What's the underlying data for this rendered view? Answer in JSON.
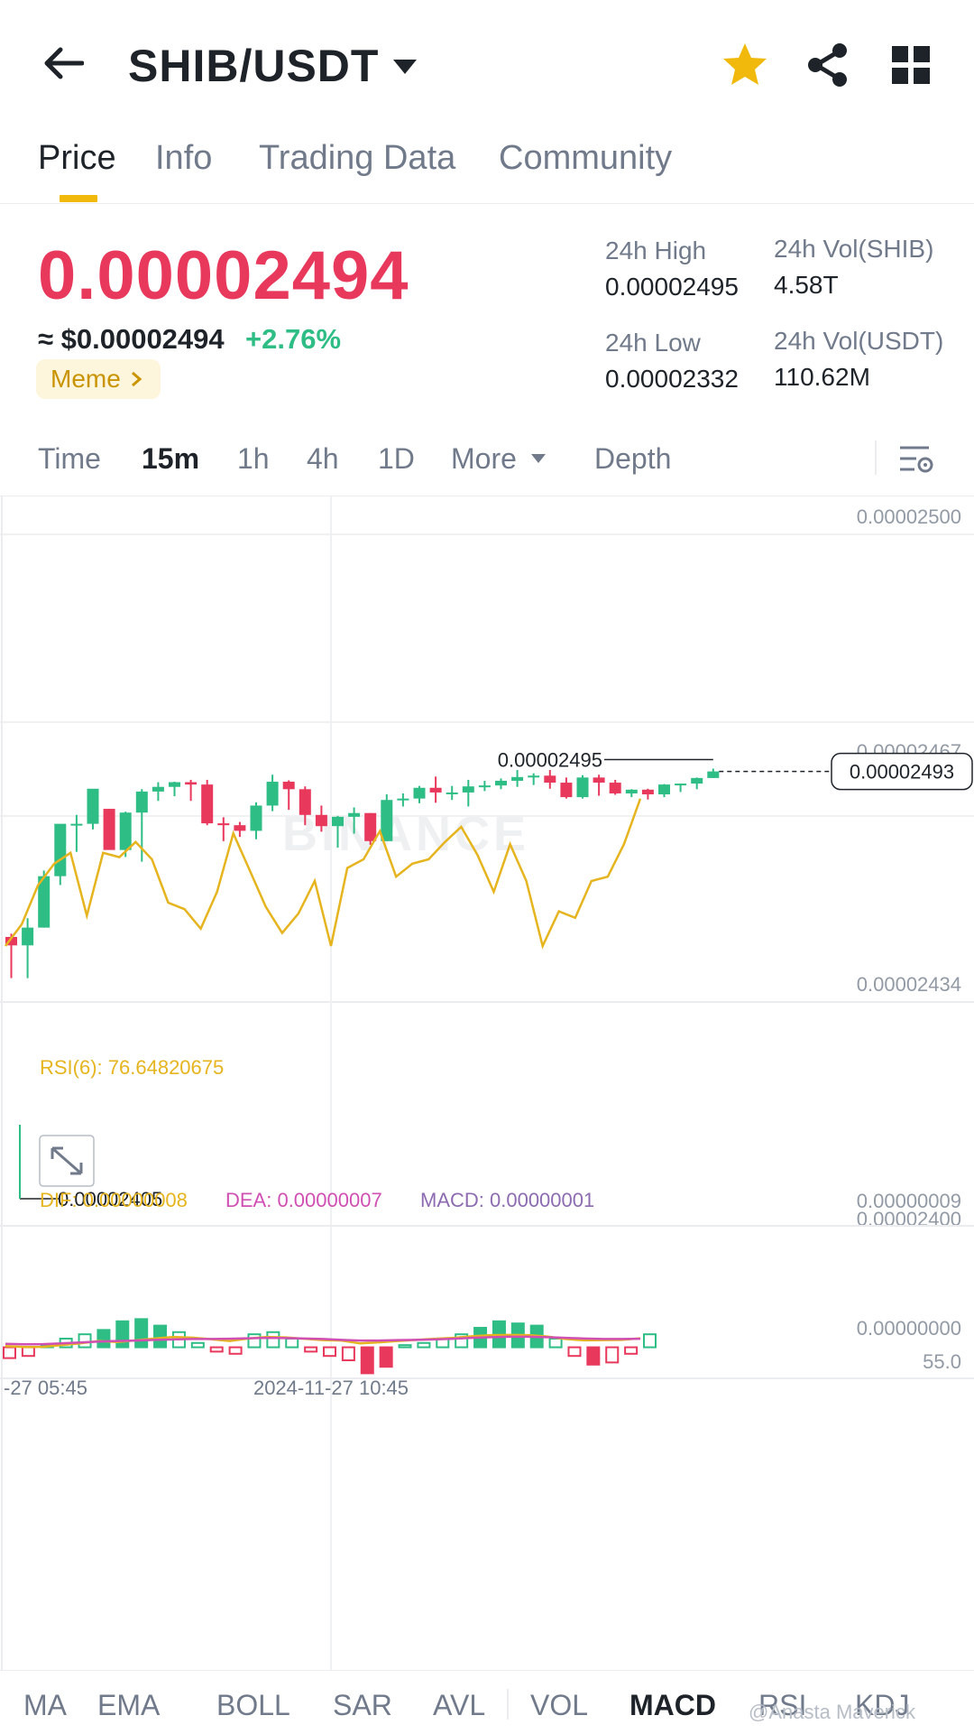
{
  "header": {
    "pair": "SHIB/USDT"
  },
  "tabs": [
    {
      "label": "Price",
      "active": true
    },
    {
      "label": "Info"
    },
    {
      "label": "Trading Data"
    },
    {
      "label": "Community"
    }
  ],
  "ticker": {
    "last_price": "0.00002494",
    "usd_price": "≈ $0.00002494",
    "change": "+2.76%",
    "tag": "Meme",
    "high_label": "24h High",
    "high_value": "0.00002495",
    "low_label": "24h Low",
    "low_value": "0.00002332",
    "vol_base_label": "24h Vol(SHIB)",
    "vol_base_value": "4.58T",
    "vol_quote_label": "24h Vol(USDT)",
    "vol_quote_value": "110.62M"
  },
  "intervals": [
    {
      "label": "Time"
    },
    {
      "label": "15m",
      "active": true
    },
    {
      "label": "1h"
    },
    {
      "label": "4h"
    },
    {
      "label": "1D"
    },
    {
      "label": "More"
    },
    {
      "label": "Depth"
    }
  ],
  "colors": {
    "up": "#2ebd85",
    "down": "#e8395c",
    "accent": "#f0b90b",
    "rsi": "#e6b41e",
    "dif": "#e6b41e",
    "dea": "#d04fb3",
    "macd": "#8c6bb1"
  },
  "chart_data": {
    "type": "candlestick",
    "y_axis_labels": [
      "0.00002500",
      "0.00002467",
      "0.00002434",
      "0.00002400"
    ],
    "ylim": [
      2.4e-05,
      2.5e-05
    ],
    "current_price_tag": "0.00002493",
    "max_label": "0.00002495",
    "min_label": "0.00002405",
    "watermark": "BINANCE",
    "x_axis_labels": [
      "-27 05:45",
      "2024-11-27 10:45"
    ],
    "candles": [
      {
        "o": 24139,
        "h": 24146,
        "l": 24051,
        "c": 24121
      },
      {
        "o": 24121,
        "h": 24179,
        "l": 24051,
        "c": 24159
      },
      {
        "o": 24159,
        "h": 24281,
        "l": 24159,
        "c": 24269
      },
      {
        "o": 24269,
        "h": 24330,
        "l": 24250,
        "c": 24381
      },
      {
        "o": 24381,
        "h": 24400,
        "l": 24321,
        "c": 24381
      },
      {
        "o": 24381,
        "h": 24413,
        "l": 24369,
        "c": 24456
      },
      {
        "o": 24413,
        "h": 24413,
        "l": 24330,
        "c": 24325
      },
      {
        "o": 24325,
        "h": 24407,
        "l": 24310,
        "c": 24405
      },
      {
        "o": 24405,
        "h": 24455,
        "l": 24300,
        "c": 24450
      },
      {
        "o": 24450,
        "h": 24470,
        "l": 24430,
        "c": 24460
      },
      {
        "o": 24460,
        "h": 24471,
        "l": 24440,
        "c": 24470
      },
      {
        "o": 24470,
        "h": 24475,
        "l": 24430,
        "c": 24465
      },
      {
        "o": 24465,
        "h": 24475,
        "l": 24378,
        "c": 24382
      },
      {
        "o": 24382,
        "h": 24395,
        "l": 24344,
        "c": 24378
      },
      {
        "o": 24378,
        "h": 24385,
        "l": 24353,
        "c": 24366
      },
      {
        "o": 24366,
        "h": 24427,
        "l": 24348,
        "c": 24420
      },
      {
        "o": 24420,
        "h": 24486,
        "l": 24408,
        "c": 24471
      },
      {
        "o": 24471,
        "h": 24474,
        "l": 24411,
        "c": 24455
      },
      {
        "o": 24455,
        "h": 24461,
        "l": 24378,
        "c": 24400
      },
      {
        "o": 24400,
        "h": 24420,
        "l": 24364,
        "c": 24376
      },
      {
        "o": 24376,
        "h": 24398,
        "l": 24330,
        "c": 24396
      },
      {
        "o": 24396,
        "h": 24416,
        "l": 24360,
        "c": 24404
      },
      {
        "o": 24404,
        "h": 24404,
        "l": 24336,
        "c": 24344
      },
      {
        "o": 24344,
        "h": 24444,
        "l": 24344,
        "c": 24432
      },
      {
        "o": 24432,
        "h": 24446,
        "l": 24418,
        "c": 24435
      },
      {
        "o": 24435,
        "h": 24462,
        "l": 24425,
        "c": 24458
      },
      {
        "o": 24458,
        "h": 24482,
        "l": 24426,
        "c": 24448
      },
      {
        "o": 24448,
        "h": 24462,
        "l": 24432,
        "c": 24448
      },
      {
        "o": 24448,
        "h": 24475,
        "l": 24418,
        "c": 24461
      },
      {
        "o": 24461,
        "h": 24473,
        "l": 24451,
        "c": 24463
      },
      {
        "o": 24463,
        "h": 24478,
        "l": 24455,
        "c": 24473
      },
      {
        "o": 24473,
        "h": 24496,
        "l": 24460,
        "c": 24481
      },
      {
        "o": 24481,
        "h": 24489,
        "l": 24464,
        "c": 24484
      },
      {
        "o": 24484,
        "h": 24496,
        "l": 24456,
        "c": 24469
      },
      {
        "o": 24469,
        "h": 24480,
        "l": 24435,
        "c": 24438
      },
      {
        "o": 24438,
        "h": 24485,
        "l": 24435,
        "c": 24480
      },
      {
        "o": 24480,
        "h": 24486,
        "l": 24441,
        "c": 24469
      },
      {
        "o": 24469,
        "h": 24475,
        "l": 24443,
        "c": 24446
      },
      {
        "o": 24446,
        "h": 24455,
        "l": 24438,
        "c": 24454
      },
      {
        "o": 24454,
        "h": 24456,
        "l": 24433,
        "c": 24444
      },
      {
        "o": 24444,
        "h": 24466,
        "l": 24438,
        "c": 24465
      },
      {
        "o": 24465,
        "h": 24467,
        "l": 24449,
        "c": 24467
      },
      {
        "o": 24467,
        "h": 24480,
        "l": 24455,
        "c": 24479
      },
      {
        "o": 24479,
        "h": 24499,
        "l": 24479,
        "c": 24493
      }
    ],
    "rsi": {
      "label": "RSI(6): 76.64820675",
      "axis_label": "55.0",
      "ylim": [
        20,
        90
      ],
      "values": [
        20,
        30,
        48,
        58,
        63,
        34,
        63,
        61,
        68,
        60,
        40,
        37,
        28,
        45,
        72,
        55,
        38,
        26,
        35,
        50,
        20,
        56,
        60,
        73,
        52,
        58,
        60,
        68,
        75,
        62,
        45,
        67,
        50,
        20,
        36,
        33,
        50,
        52,
        67,
        88
      ]
    },
    "macd": {
      "dif_label": "DIF: 0.00000008",
      "dea_label": "DEA: 0.00000007",
      "macd_label": "MACD: 0.00000001",
      "axis_labels": [
        "0.00000009",
        "0.00000000"
      ],
      "ylim": [
        -2.2e-08,
        1.16e-07
      ],
      "dif": [
        1.0,
        0.2,
        0.4,
        2.0,
        3.4,
        5.6,
        4.6,
        6.2,
        7.8,
        9.2,
        8.6,
        7.2,
        5.6,
        7.8,
        9.2,
        8.8,
        7.6,
        6.4,
        6.0,
        3.4,
        4.4,
        5.6,
        6.6,
        7.6,
        8.4,
        9.8,
        10.8,
        11.0,
        10.8,
        9.6,
        7.4,
        6.2,
        6.4,
        6.6,
        8.0
      ],
      "dea": [
        3.0,
        2.6,
        2.8,
        3.4,
        4.2,
        5.0,
        5.6,
        6.0,
        6.6,
        7.0,
        7.4,
        7.4,
        7.6,
        8.0,
        8.4,
        8.2,
        7.8,
        7.4,
        6.6,
        6.0,
        6.0,
        6.4,
        6.6,
        7.0,
        7.6,
        8.4,
        9.0,
        9.4,
        9.4,
        9.0,
        8.4,
        7.8,
        7.4,
        7.4,
        7.6
      ],
      "hist": [
        -1.0,
        -0.8,
        0.2,
        0.8,
        1.2,
        1.6,
        2.4,
        2.6,
        2.0,
        1.4,
        0.4,
        -0.4,
        -0.6,
        1.2,
        1.4,
        0.8,
        -0.4,
        -0.8,
        -1.2,
        -2.4,
        -1.8,
        0.2,
        0.4,
        0.8,
        1.2,
        1.8,
        2.4,
        2.2,
        2.0,
        0.8,
        -0.8,
        -1.6,
        -1.4,
        -0.6,
        1.2
      ]
    }
  },
  "indicators": [
    {
      "label": "MA"
    },
    {
      "label": "EMA"
    },
    {
      "label": "BOLL"
    },
    {
      "label": "SAR"
    },
    {
      "label": "AVL"
    },
    {
      "label": "VOL"
    },
    {
      "label": "MACD",
      "active": true
    },
    {
      "label": "RSI"
    },
    {
      "label": "KDJ"
    }
  ],
  "credit": "@Anasta Maverick"
}
